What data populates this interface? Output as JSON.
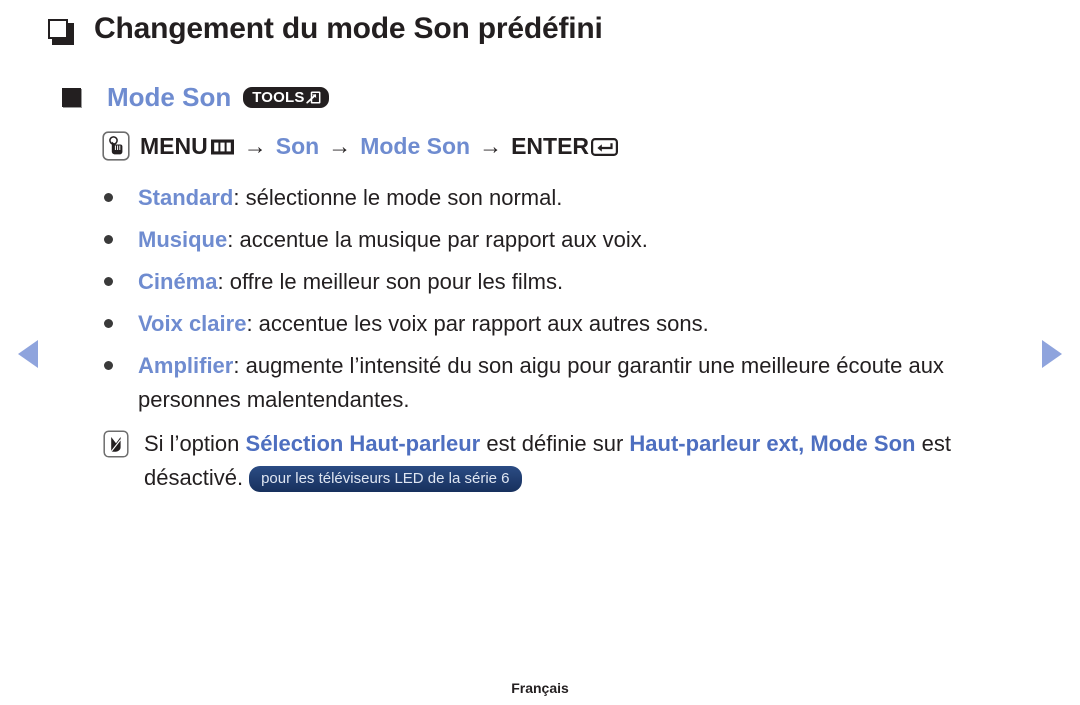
{
  "page": {
    "title": "Changement du mode Son prédéfini",
    "footer_language": "Français"
  },
  "section": {
    "heading": "Mode Son",
    "tools_badge_label": "TOOLS",
    "tools_badge_icon": "tools-arrow-icon"
  },
  "nav_path": {
    "press_icon": "press-button-icon",
    "menu_label": "MENU",
    "menu_icon": "menu-grid-icon",
    "arrow1": "→",
    "step1": "Son",
    "arrow2": "→",
    "step2": "Mode Son",
    "arrow3": "→",
    "enter_label": "ENTER",
    "enter_icon": "enter-key-icon"
  },
  "options": [
    {
      "term": "Standard",
      "separator": ": ",
      "description": "sélectionne le mode son normal."
    },
    {
      "term": "Musique",
      "separator": ": ",
      "description": "accentue la musique par rapport aux voix."
    },
    {
      "term": "Cinéma",
      "separator": ": ",
      "description": "offre le meilleur son pour les films."
    },
    {
      "term": "Voix claire",
      "separator": ": ",
      "description": "accentue les voix par rapport aux autres sons."
    },
    {
      "term": "Amplifier",
      "separator": ": ",
      "description": "augmente l’intensité du son aigu pour garantir une meilleure écoute aux personnes malentendantes."
    }
  ],
  "note": {
    "icon": "note-pencil-icon",
    "part1": "Si l’option ",
    "highlight1": "Sélection Haut-parleur",
    "part2": " est définie sur ",
    "highlight2": "Haut-parleur ext, Mode Son",
    "part3": " est désactivé.",
    "model_pill": "pour les téléviseurs LED de la série 6"
  },
  "pagination": {
    "prev_icon": "previous-page-arrow",
    "next_icon": "next-page-arrow"
  },
  "colors": {
    "accent_blue": "#6f8cd0",
    "note_blue": "#4e6fc0",
    "arrow_blue": "#8fa4dd",
    "ink": "#231f20",
    "pill_navy": "#1c3664"
  }
}
